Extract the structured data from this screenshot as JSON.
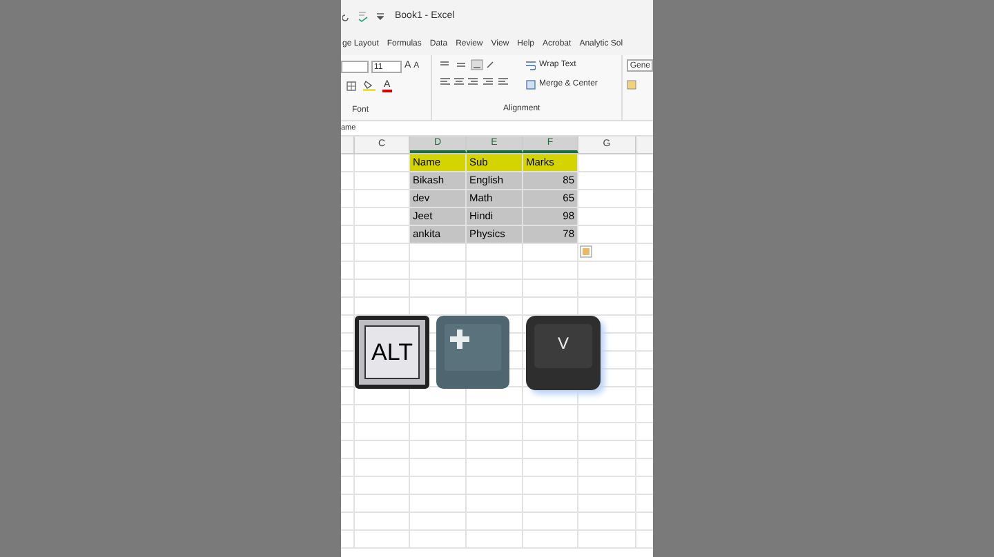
{
  "window": {
    "title": "Book1  -  Excel"
  },
  "tabs": [
    {
      "label": "ge Layout"
    },
    {
      "label": "Formulas"
    },
    {
      "label": "Data"
    },
    {
      "label": "Review"
    },
    {
      "label": "View"
    },
    {
      "label": "Help"
    },
    {
      "label": "Acrobat"
    },
    {
      "label": "Analytic Sol"
    }
  ],
  "ribbon": {
    "font_size": "11",
    "grow_font": "A",
    "shrink_font": "A",
    "font_color": "A",
    "wrap_text": "Wrap Text",
    "merge": "Merge & Center",
    "number_format": "Gene",
    "groups": [
      "Font",
      "Alignment"
    ]
  },
  "name_box": "ame",
  "sheet": {
    "columns": [
      {
        "label": "C",
        "selected": false
      },
      {
        "label": "D",
        "selected": true
      },
      {
        "label": "E",
        "selected": true
      },
      {
        "label": "F",
        "selected": true
      },
      {
        "label": "G",
        "selected": false
      }
    ],
    "rows": [
      {
        "kind": "header",
        "selected": true,
        "cells": [
          "",
          "Name",
          "Sub",
          "Marks"
        ]
      },
      {
        "kind": "data",
        "selected": true,
        "cells": [
          "",
          "Bikash",
          "English",
          "85"
        ]
      },
      {
        "kind": "data",
        "selected": true,
        "cells": [
          "",
          "dev",
          "Math",
          "65"
        ]
      },
      {
        "kind": "data",
        "selected": true,
        "cells": [
          "",
          "Jeet",
          "Hindi",
          "98"
        ]
      },
      {
        "kind": "data",
        "selected": true,
        "cells": [
          "",
          "ankita",
          "Physics",
          "78"
        ]
      }
    ]
  },
  "keys": [
    {
      "kind": "light",
      "label": "ALT"
    },
    {
      "kind": "plus"
    },
    {
      "kind": "dark",
      "label": "V"
    }
  ]
}
